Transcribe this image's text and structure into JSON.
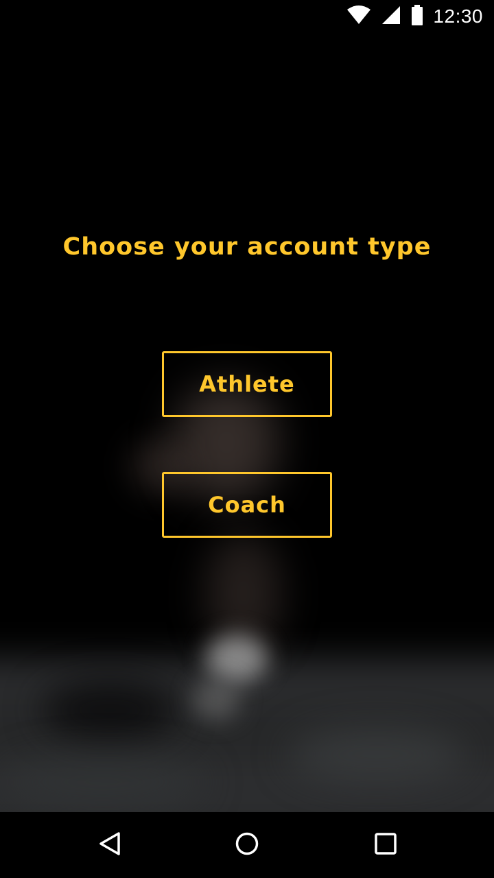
{
  "status_bar": {
    "time": "12:30",
    "icons": [
      "wifi-icon",
      "cellular-signal-icon",
      "battery-icon"
    ]
  },
  "screen": {
    "title": "Choose your account type",
    "accent_color": "#ffc72c",
    "background": "blurred photo of a runner"
  },
  "options": {
    "athlete_label": "Athlete",
    "coach_label": "Coach"
  },
  "navigation_bar": {
    "buttons": [
      "back-icon",
      "home-icon",
      "recents-icon"
    ]
  }
}
